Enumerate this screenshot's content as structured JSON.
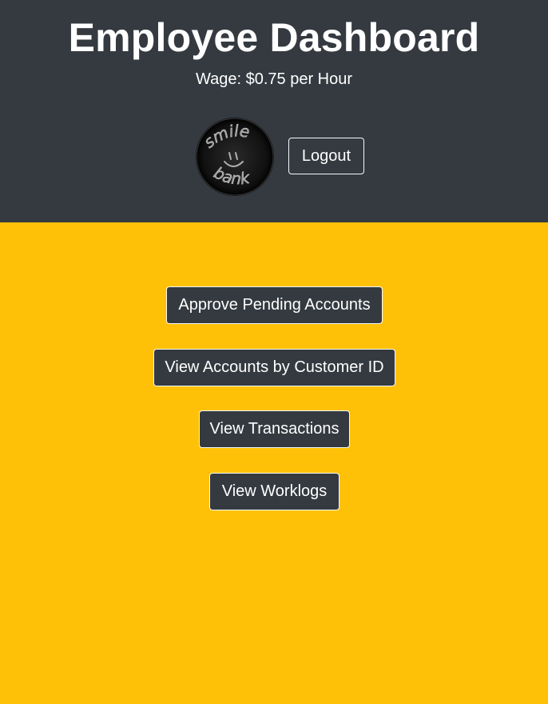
{
  "header": {
    "title": "Employee Dashboard",
    "wage_text": "Wage: $0.75 per Hour",
    "logo_text_top": "smile",
    "logo_text_bottom": "bank",
    "logout_label": "Logout"
  },
  "actions": {
    "approve_pending_label": "Approve Pending Accounts",
    "view_accounts_label": "View Accounts by Customer ID",
    "view_transactions_label": "View Transactions",
    "view_worklogs_label": "View Worklogs"
  },
  "colors": {
    "header_bg": "#343a40",
    "page_bg": "#ffc107",
    "button_bg": "#343a40",
    "button_text": "#ffffff"
  }
}
